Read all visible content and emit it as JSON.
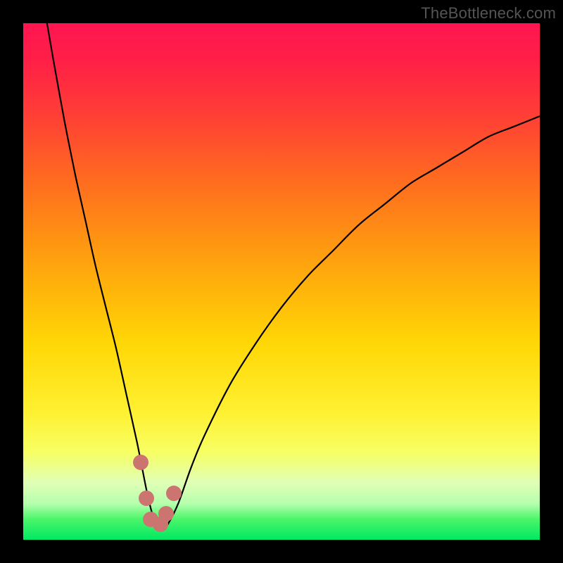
{
  "attribution": "TheBottleneck.com",
  "colors": {
    "background": "#000000",
    "gradient_top": "#ff1550",
    "gradient_bottom": "#00e862",
    "curve": "#000000",
    "marker": "#cc7570"
  },
  "chart_data": {
    "type": "line",
    "title": "",
    "xlabel": "",
    "ylabel": "",
    "xlim": [
      0,
      100
    ],
    "ylim": [
      0,
      100
    ],
    "series": [
      {
        "name": "bottleneck-curve",
        "x": [
          4.6,
          6,
          8,
          10,
          12,
          14,
          16,
          18,
          20,
          22,
          23,
          24,
          25,
          26,
          27,
          28,
          30,
          32.5,
          35,
          40,
          45,
          50,
          55,
          60,
          65,
          70,
          75,
          80,
          85,
          90,
          95,
          100
        ],
        "values": [
          100,
          92,
          81,
          71,
          62,
          53,
          45,
          37,
          28,
          19,
          14,
          9,
          5,
          3,
          2,
          3,
          7,
          14,
          20,
          30,
          38,
          45,
          51,
          56,
          61,
          65,
          69,
          72,
          75,
          78,
          80,
          82
        ]
      }
    ],
    "markers": [
      {
        "x": 22.7,
        "y": 15
      },
      {
        "x": 23.9,
        "y": 8
      },
      {
        "x": 24.6,
        "y": 4
      },
      {
        "x": 26.5,
        "y": 3
      },
      {
        "x": 27.6,
        "y": 5
      },
      {
        "x": 29.2,
        "y": 9
      }
    ],
    "annotations": []
  }
}
